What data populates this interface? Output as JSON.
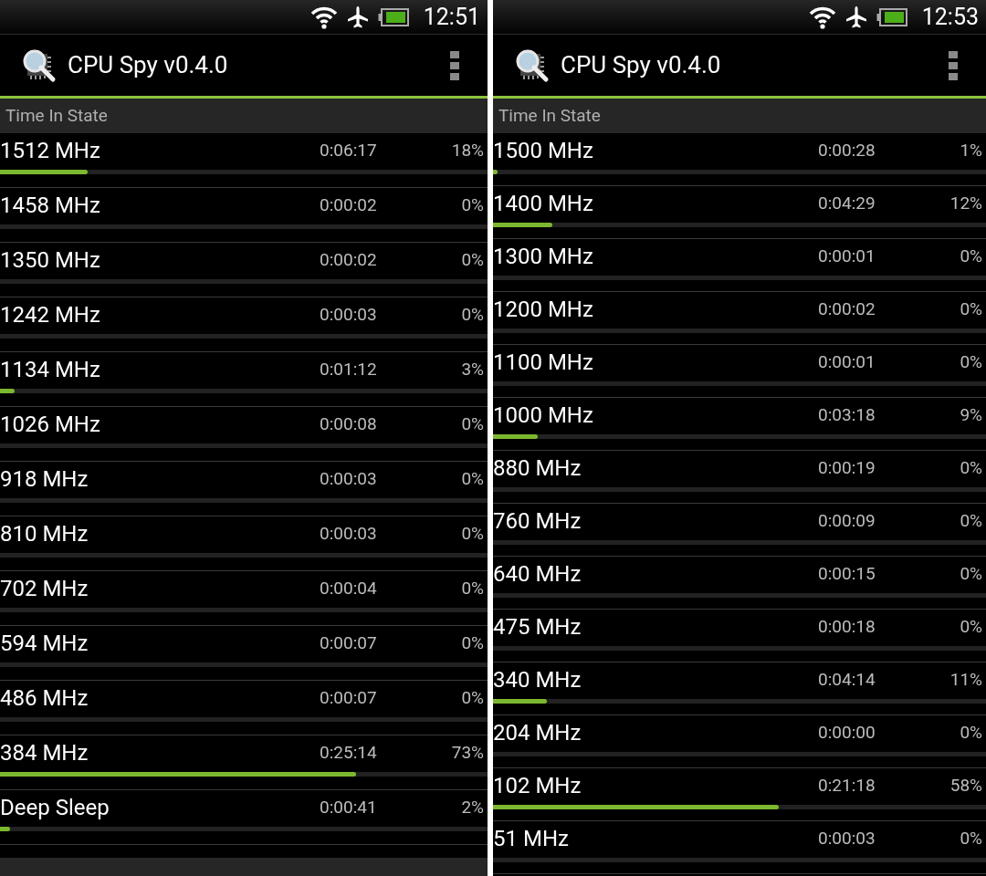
{
  "screens": [
    {
      "status_bar": {
        "time": "12:51"
      },
      "app_bar": {
        "title": "CPU Spy v0.4.0"
      },
      "section": "Time In State",
      "footer_band": true,
      "states": [
        {
          "label": "1512 MHz",
          "time": "0:06:17",
          "percent": "18%",
          "level": 0.18
        },
        {
          "label": "1458 MHz",
          "time": "0:00:02",
          "percent": "0%"
        },
        {
          "label": "1350 MHz",
          "time": "0:00:02",
          "percent": "0%"
        },
        {
          "label": "1242 MHz",
          "time": "0:00:03",
          "percent": "0%"
        },
        {
          "label": "1134 MHz",
          "time": "0:01:12",
          "percent": "3%",
          "level": 0.03
        },
        {
          "label": "1026 MHz",
          "time": "0:00:08",
          "percent": "0%"
        },
        {
          "label": "918 MHz",
          "time": "0:00:03",
          "percent": "0%"
        },
        {
          "label": "810 MHz",
          "time": "0:00:03",
          "percent": "0%"
        },
        {
          "label": "702 MHz",
          "time": "0:00:04",
          "percent": "0%"
        },
        {
          "label": "594 MHz",
          "time": "0:00:07",
          "percent": "0%"
        },
        {
          "label": "486 MHz",
          "time": "0:00:07",
          "percent": "0%"
        },
        {
          "label": "384 MHz",
          "time": "0:25:14",
          "percent": "73%",
          "level": 0.73
        },
        {
          "label": "Deep Sleep",
          "time": "0:00:41",
          "percent": "2%",
          "level": 0.02
        }
      ]
    },
    {
      "status_bar": {
        "time": "12:53"
      },
      "app_bar": {
        "title": "CPU Spy v0.4.0"
      },
      "section": "Time In State",
      "states": [
        {
          "label": "1500 MHz",
          "time": "0:00:28",
          "percent": "1%",
          "level": 0.01
        },
        {
          "label": "1400 MHz",
          "time": "0:04:29",
          "percent": "12%",
          "level": 0.12
        },
        {
          "label": "1300 MHz",
          "time": "0:00:01",
          "percent": "0%"
        },
        {
          "label": "1200 MHz",
          "time": "0:00:02",
          "percent": "0%"
        },
        {
          "label": "1100 MHz",
          "time": "0:00:01",
          "percent": "0%"
        },
        {
          "label": "1000 MHz",
          "time": "0:03:18",
          "percent": "9%",
          "level": 0.09
        },
        {
          "label": "880 MHz",
          "time": "0:00:19",
          "percent": "0%"
        },
        {
          "label": "760 MHz",
          "time": "0:00:09",
          "percent": "0%"
        },
        {
          "label": "640 MHz",
          "time": "0:00:15",
          "percent": "0%"
        },
        {
          "label": "475 MHz",
          "time": "0:00:18",
          "percent": "0%"
        },
        {
          "label": "340 MHz",
          "time": "0:04:14",
          "percent": "11%",
          "level": 0.11
        },
        {
          "label": "204 MHz",
          "time": "0:00:00",
          "percent": "0%"
        },
        {
          "label": "102 MHz",
          "time": "0:21:18",
          "percent": "58%",
          "level": 0.58
        },
        {
          "label": "51 MHz",
          "time": "0:00:03",
          "percent": "0%"
        }
      ]
    }
  ]
}
